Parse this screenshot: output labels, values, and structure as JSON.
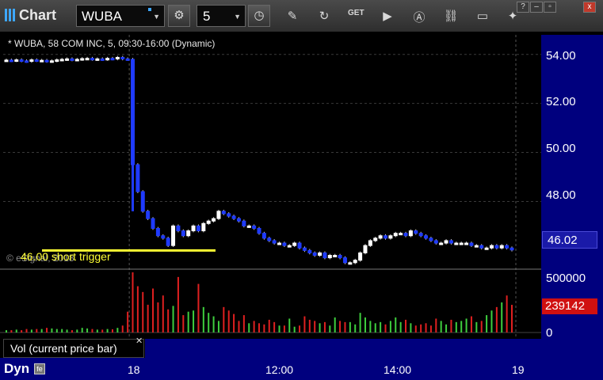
{
  "window": {
    "title": "Chart",
    "buttons": {
      "help": "?",
      "minimize": "–",
      "restore": "▫",
      "close": "x"
    }
  },
  "toolbar": {
    "symbol": "WUBA",
    "interval": "5",
    "icons": [
      "settings-gear-icon",
      "clock-icon",
      "pencil-icon",
      "refresh-icon",
      "get-icon",
      "play-icon",
      "a-icon",
      "link-icon",
      "chat-icon",
      "twitter-icon"
    ]
  },
  "chart": {
    "header": "* WUBA, 58 COM INC, 5, 09:30-16:00 (Dynamic)",
    "copyright": "© eSignal, 2018",
    "annotation": "46.00 short trigger",
    "price_labels": [
      "54.00",
      "52.00",
      "50.00",
      "48.00"
    ],
    "last_price": "46.02",
    "volume_labels": [
      "500000",
      "0"
    ],
    "volume_last": "239142",
    "vol_legend": "Vol (current price bar)",
    "time_labels": [
      "18",
      "12:00",
      "14:00",
      "19"
    ],
    "dyn_label": "Dyn"
  },
  "chart_data": {
    "type": "candlestick",
    "ylim": [
      45.3,
      54.8
    ],
    "price_ticks": [
      54,
      52,
      50,
      48
    ],
    "annotation_line": 46.0,
    "prices": [
      53.77,
      53.75,
      53.78,
      53.74,
      53.72,
      53.78,
      53.75,
      53.76,
      53.72,
      53.74,
      53.78,
      53.8,
      53.82,
      53.78,
      53.8,
      53.83,
      53.84,
      53.8,
      53.82,
      53.8,
      53.84,
      53.82,
      53.88,
      53.82,
      53.8,
      49.5,
      48.4,
      47.6,
      47.3,
      46.9,
      46.6,
      46.5,
      46.2,
      47.0,
      46.8,
      46.6,
      46.8,
      47.0,
      46.8,
      47.1,
      47.2,
      47.3,
      47.6,
      47.5,
      47.4,
      47.3,
      47.2,
      47.0,
      47.0,
      46.9,
      46.7,
      46.5,
      46.4,
      46.3,
      46.3,
      46.2,
      46.2,
      46.3,
      46.1,
      46.0,
      45.9,
      45.8,
      45.9,
      45.7,
      45.8,
      45.8,
      45.7,
      45.5,
      45.5,
      45.6,
      45.9,
      46.2,
      46.4,
      46.5,
      46.6,
      46.5,
      46.6,
      46.7,
      46.7,
      46.6,
      46.8,
      46.7,
      46.6,
      46.5,
      46.4,
      46.3,
      46.3,
      46.4,
      46.3,
      46.3,
      46.3,
      46.3,
      46.2,
      46.2,
      46.1,
      46.1,
      46.2,
      46.1,
      46.2,
      46.1,
      46.02
    ],
    "volume": [
      20000,
      20000,
      25000,
      20000,
      30000,
      25000,
      30000,
      30000,
      40000,
      35000,
      30000,
      30000,
      25000,
      20000,
      25000,
      40000,
      35000,
      30000,
      25000,
      25000,
      30000,
      28000,
      40000,
      60000,
      180000,
      520000,
      400000,
      350000,
      240000,
      380000,
      260000,
      320000,
      200000,
      230000,
      480000,
      150000,
      180000,
      190000,
      420000,
      220000,
      170000,
      140000,
      100000,
      220000,
      190000,
      160000,
      100000,
      150000,
      80000,
      100000,
      80000,
      70000,
      110000,
      90000,
      60000,
      60000,
      120000,
      50000,
      60000,
      140000,
      110000,
      100000,
      80000,
      90000,
      60000,
      130000,
      100000,
      90000,
      90000,
      70000,
      170000,
      130000,
      100000,
      80000,
      90000,
      70000,
      100000,
      130000,
      90000,
      110000,
      80000,
      60000,
      70000,
      80000,
      60000,
      120000,
      100000,
      70000,
      110000,
      90000,
      100000,
      120000,
      140000,
      90000,
      100000,
      150000,
      190000,
      220000,
      260000,
      320000,
      239142
    ],
    "vol_ylim": [
      0,
      520000
    ]
  }
}
